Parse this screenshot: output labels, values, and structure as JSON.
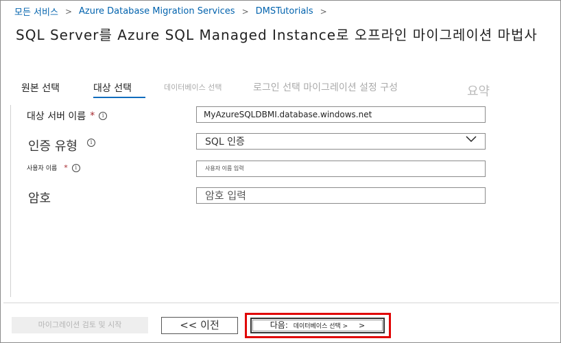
{
  "breadcrumb": {
    "items": [
      "모든 서비스",
      "Azure Database Migration Services",
      "DMSTutorials"
    ],
    "separator": ">"
  },
  "page_title": "SQL Server를 Azure SQL Managed Instance로 오프라인 마이그레이션 마법사",
  "tabs": [
    {
      "label": "원본 선택",
      "state": "completed"
    },
    {
      "label": "대상 선택",
      "state": "active"
    },
    {
      "label": "데이터베이스 선택",
      "state": "disabled"
    },
    {
      "label": "로그인 선택 마이그레이션 설정 구성",
      "state": "disabled"
    },
    {
      "label": "요약",
      "state": "disabled"
    }
  ],
  "form": {
    "target_server": {
      "label": "대상 서버 이름",
      "required_mark": "*",
      "value": "MyAzureSQLDBMI.database.windows.net"
    },
    "auth_type": {
      "label": "인증 유형",
      "value": "SQL 인증"
    },
    "username": {
      "label": "사용자 이름",
      "required_mark": "*",
      "placeholder": "사용자 이름 입력"
    },
    "password": {
      "label": "암호",
      "placeholder": "암호 입력"
    }
  },
  "footer": {
    "review_button": "마이그레이션 검토 및 시작",
    "prev_button": "<< 이전",
    "next_button_prefix": "다음:",
    "next_button_target": "데이터베이스 선택 >",
    "next_button_suffix": ">"
  },
  "colors": {
    "link": "#0062ad",
    "active_tab_underline": "#0f6cbd",
    "required": "#a4262c",
    "highlight": "#e00000"
  },
  "icons": [
    "info-icon",
    "chevron-down-icon"
  ]
}
